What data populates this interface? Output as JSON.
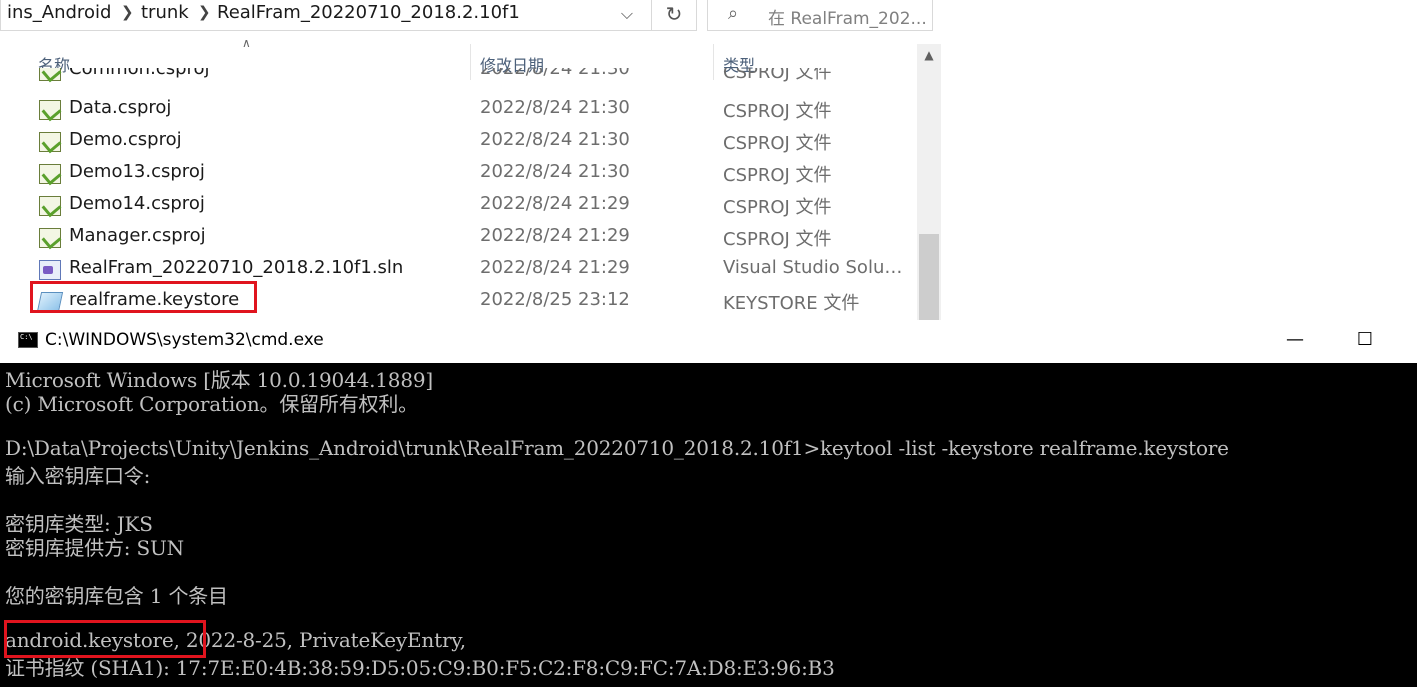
{
  "explorer": {
    "breadcrumb": [
      "ins_Android",
      "trunk",
      "RealFram_20220710_2018.2.10f1"
    ],
    "search_placeholder": "在 RealFram_202...",
    "columns": {
      "name": "名称",
      "date": "修改日期",
      "type": "类型"
    },
    "partial_row": {
      "name": "Common.csproj",
      "date": "2022/8/24 21:30",
      "type": "CSPROJ 文件"
    },
    "files": [
      {
        "name": "Data.csproj",
        "date": "2022/8/24 21:30",
        "type": "CSPROJ 文件",
        "icon": "csproj-icon"
      },
      {
        "name": "Demo.csproj",
        "date": "2022/8/24 21:30",
        "type": "CSPROJ 文件",
        "icon": "csproj-icon"
      },
      {
        "name": "Demo13.csproj",
        "date": "2022/8/24 21:30",
        "type": "CSPROJ 文件",
        "icon": "csproj-icon"
      },
      {
        "name": "Demo14.csproj",
        "date": "2022/8/24 21:29",
        "type": "CSPROJ 文件",
        "icon": "csproj-icon"
      },
      {
        "name": "Manager.csproj",
        "date": "2022/8/24 21:29",
        "type": "CSPROJ 文件",
        "icon": "csproj-icon"
      },
      {
        "name": "RealFram_20220710_2018.2.10f1.sln",
        "date": "2022/8/24 21:29",
        "type": "Visual Studio Soluti...",
        "icon": "sln-icon"
      },
      {
        "name": "realframe.keystore",
        "date": "2022/8/25 23:12",
        "type": "KEYSTORE 文件",
        "icon": "keystore-icon"
      }
    ],
    "highlight_color": "#e0141e"
  },
  "cmd": {
    "title": "C:\\WINDOWS\\system32\\cmd.exe",
    "lines": [
      "Microsoft Windows [版本 10.0.19044.1889]",
      "(c) Microsoft Corporation。保留所有权利。",
      "",
      "D:\\Data\\Projects\\Unity\\Jenkins_Android\\trunk\\RealFram_20220710_2018.2.10f1>keytool -list -keystore realframe.keystore",
      "输入密钥库口令:",
      "",
      "密钥库类型: JKS",
      "密钥库提供方: SUN",
      "",
      "您的密钥库包含 1 个条目",
      "",
      "android.keystore, 2022-8-25, PrivateKeyEntry,",
      "证书指纹 (SHA1): 17:7E:E0:4B:38:59:D5:05:C9:B0:F5:C2:F8:C9:FC:7A:D8:E3:96:B3"
    ],
    "text_color": "#c0c0c0",
    "background": "#000000"
  }
}
